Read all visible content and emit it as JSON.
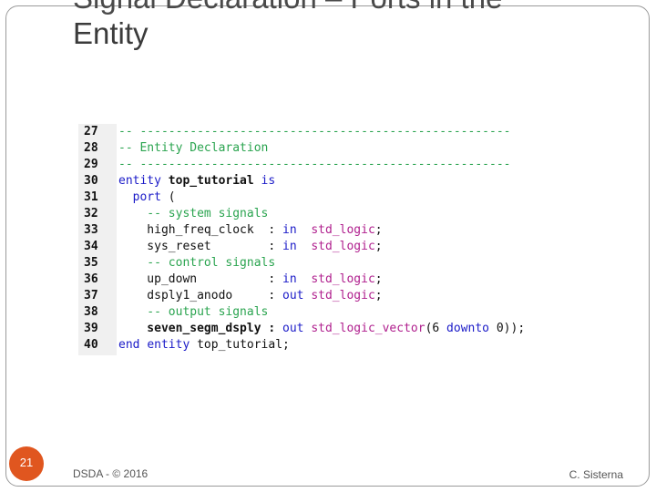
{
  "slide": {
    "title_line1": "Signal Declaration – Ports in the",
    "title_line2": "Entity",
    "number": "21",
    "footer_left": "DSDA - © 2016",
    "footer_right": "C. Sisterna"
  },
  "code": {
    "lines": [
      {
        "n": "27",
        "parts": [
          {
            "t": "-- ----------------------------------------------------",
            "c": "c-comment"
          }
        ]
      },
      {
        "n": "28",
        "parts": [
          {
            "t": "-- Entity Declaration",
            "c": "c-comment"
          }
        ]
      },
      {
        "n": "29",
        "parts": [
          {
            "t": "-- ----------------------------------------------------",
            "c": "c-comment"
          }
        ]
      },
      {
        "n": "30",
        "parts": [
          {
            "t": "entity",
            "c": "c-kw"
          },
          {
            "t": " top_tutorial ",
            "c": "c-plain c-bold"
          },
          {
            "t": "is",
            "c": "c-kw"
          }
        ]
      },
      {
        "n": "31",
        "parts": [
          {
            "t": "  port",
            "c": "c-kw"
          },
          {
            "t": " (",
            "c": "c-plain"
          }
        ]
      },
      {
        "n": "32",
        "parts": [
          {
            "t": "    -- system signals",
            "c": "c-comment"
          }
        ]
      },
      {
        "n": "33",
        "parts": [
          {
            "t": "    high_freq_clock  : ",
            "c": "c-plain"
          },
          {
            "t": "in",
            "c": "c-kw"
          },
          {
            "t": "  ",
            "c": "c-plain"
          },
          {
            "t": "std_logic",
            "c": "c-type"
          },
          {
            "t": ";",
            "c": "c-plain"
          }
        ]
      },
      {
        "n": "34",
        "parts": [
          {
            "t": "    sys_reset        : ",
            "c": "c-plain"
          },
          {
            "t": "in",
            "c": "c-kw"
          },
          {
            "t": "  ",
            "c": "c-plain"
          },
          {
            "t": "std_logic",
            "c": "c-type"
          },
          {
            "t": ";",
            "c": "c-plain"
          }
        ]
      },
      {
        "n": "35",
        "parts": [
          {
            "t": "    -- control signals",
            "c": "c-comment"
          }
        ]
      },
      {
        "n": "36",
        "parts": [
          {
            "t": "    up_down          : ",
            "c": "c-plain"
          },
          {
            "t": "in",
            "c": "c-kw"
          },
          {
            "t": "  ",
            "c": "c-plain"
          },
          {
            "t": "std_logic",
            "c": "c-type"
          },
          {
            "t": ";",
            "c": "c-plain"
          }
        ]
      },
      {
        "n": "37",
        "parts": [
          {
            "t": "    dsply1_anodo     : ",
            "c": "c-plain"
          },
          {
            "t": "out",
            "c": "c-kw"
          },
          {
            "t": " ",
            "c": "c-plain"
          },
          {
            "t": "std_logic",
            "c": "c-type"
          },
          {
            "t": ";",
            "c": "c-plain"
          }
        ]
      },
      {
        "n": "38",
        "parts": [
          {
            "t": "    -- output signals",
            "c": "c-comment"
          }
        ]
      },
      {
        "n": "39",
        "parts": [
          {
            "t": "    seven_segm_dsply : ",
            "c": "c-plain c-bold"
          },
          {
            "t": "out",
            "c": "c-kw"
          },
          {
            "t": " ",
            "c": "c-plain"
          },
          {
            "t": "std_logic_vector",
            "c": "c-type"
          },
          {
            "t": "(6 ",
            "c": "c-plain"
          },
          {
            "t": "downto",
            "c": "c-kw"
          },
          {
            "t": " 0));",
            "c": "c-plain"
          }
        ]
      },
      {
        "n": "40",
        "parts": [
          {
            "t": "end",
            "c": "c-kw"
          },
          {
            "t": " ",
            "c": "c-plain"
          },
          {
            "t": "entity",
            "c": "c-kw"
          },
          {
            "t": " top_tutorial;",
            "c": "c-plain"
          }
        ]
      }
    ]
  }
}
